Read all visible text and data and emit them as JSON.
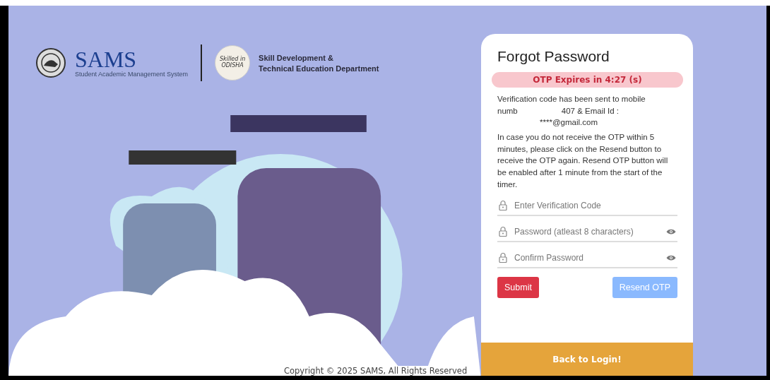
{
  "header": {
    "brand": "SAMS",
    "brand_subtitle": "Student Academic Management System",
    "partner_logo_text": "Skilled in ODISHA",
    "department_lines": [
      "Skill Development &",
      "Technical Education Department"
    ]
  },
  "card": {
    "title": "Forgot Password",
    "timer": "OTP Expires in 4:27 (s)",
    "message_parts": [
      "Verification code has been sent to mobile",
      "numb",
      "407 & Email Id :",
      "****@gmail.com"
    ],
    "info": "In case you do not receive the OTP within 5 minutes, please click on the Resend button to receive the OTP again. Resend OTP button will be enabled after 1 minute from the start of the timer.",
    "fields": [
      {
        "placeholder": "Enter Verification Code",
        "kind": "text"
      },
      {
        "placeholder": "Password (atleast 8 characters)",
        "kind": "password"
      },
      {
        "placeholder": "Confirm Password",
        "kind": "password"
      }
    ],
    "buttons": [
      {
        "label": "Submit",
        "kind": "primary",
        "disabled": false
      },
      {
        "label": "Resend OTP",
        "kind": "secondary",
        "disabled": true
      }
    ],
    "footer_link": "Back to Login!"
  },
  "copyright": "Copyright © 2025 SAMS, All Rights Reserved"
}
